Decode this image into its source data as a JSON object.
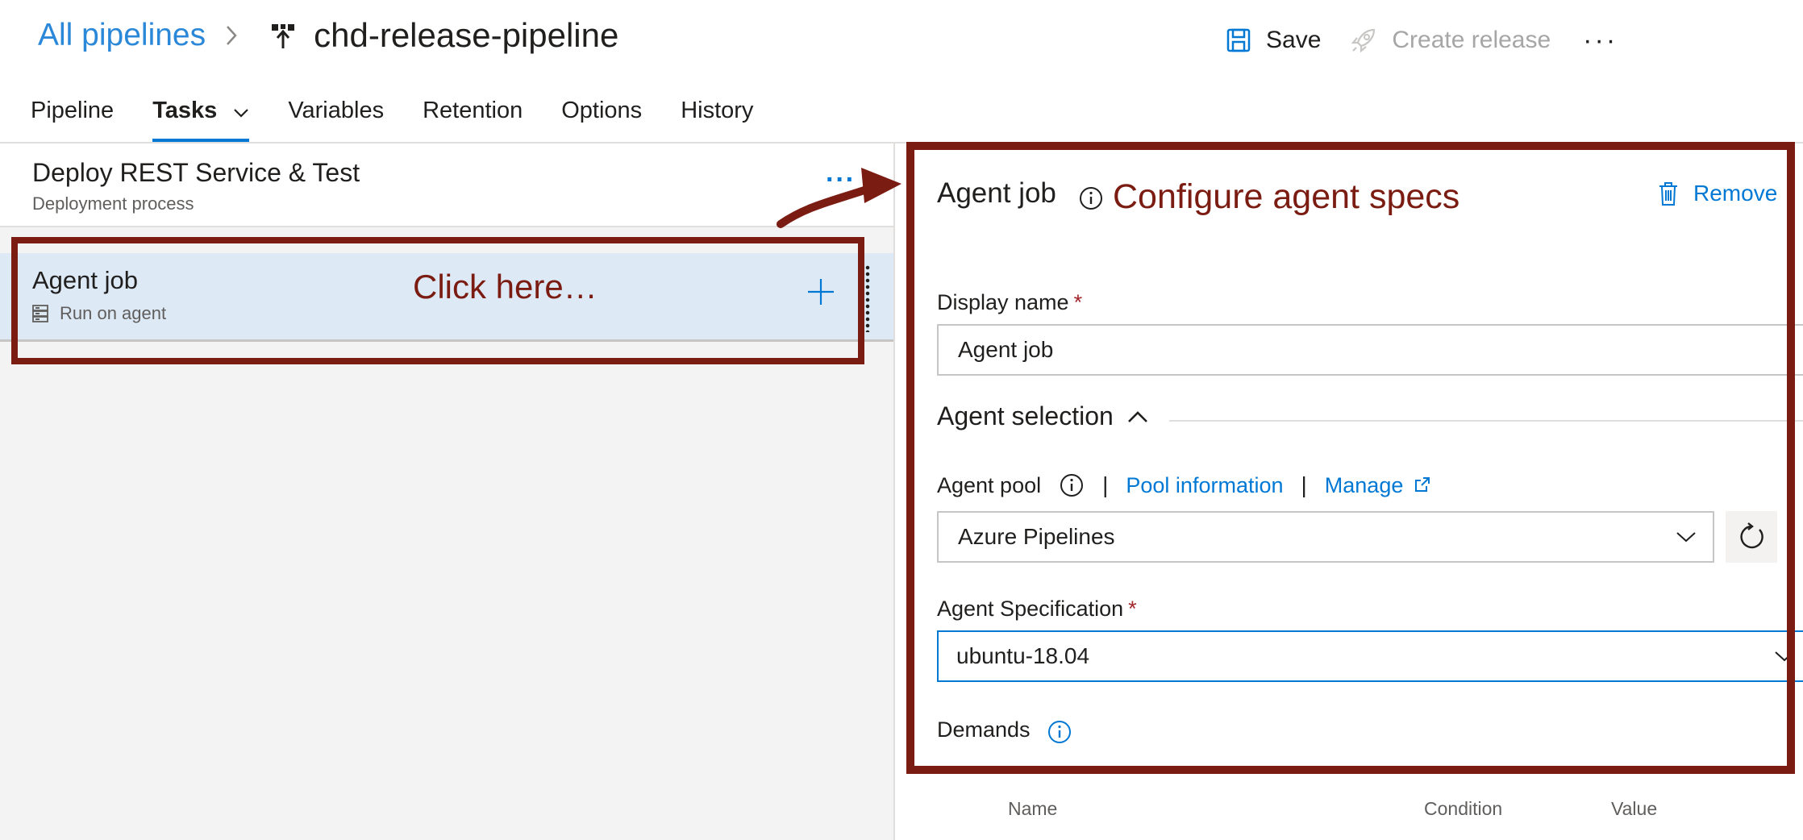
{
  "header": {
    "breadcrumb_link": "All pipelines",
    "pipeline_name": "chd-release-pipeline",
    "save_label": "Save",
    "create_release_label": "Create release",
    "more_label": "···"
  },
  "tabs": [
    {
      "label": "Pipeline"
    },
    {
      "label": "Tasks"
    },
    {
      "label": "Variables"
    },
    {
      "label": "Retention"
    },
    {
      "label": "Options"
    },
    {
      "label": "History"
    }
  ],
  "stage": {
    "title": "Deploy REST Service & Test",
    "subtitle": "Deployment process",
    "more_label": "···"
  },
  "job": {
    "title": "Agent job",
    "subtitle": "Run on agent"
  },
  "annotations": {
    "click_here": "Click here…",
    "configure": "Configure agent specs",
    "annotation_color": "#7b1c12"
  },
  "panel": {
    "title": "Agent job",
    "remove_label": "Remove",
    "display_name_label": "Display name",
    "display_name_value": "Agent job",
    "required_mark": "*",
    "agent_selection_label": "Agent selection",
    "agent_pool_label": "Agent pool",
    "separator": "|",
    "pool_information_link": "Pool information",
    "manage_link": "Manage",
    "agent_pool_value": "Azure Pipelines",
    "agent_spec_label": "Agent Specification",
    "agent_spec_value": "ubuntu-18.04",
    "demands_label": "Demands"
  },
  "demands_table": {
    "columns": [
      "Name",
      "Condition",
      "Value"
    ]
  },
  "colors": {
    "accent": "#0078d4",
    "link": "#2b88d8",
    "selected_row": "#dee9f6",
    "required": "#a4262c"
  }
}
